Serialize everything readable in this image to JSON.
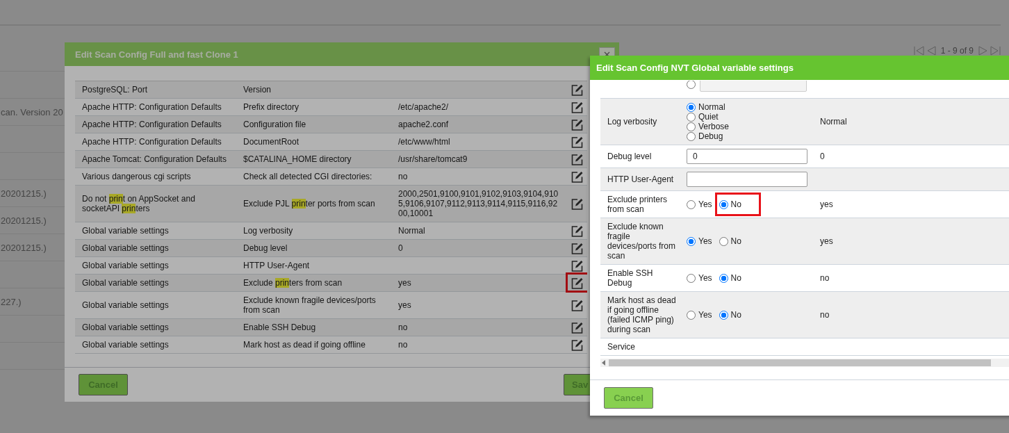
{
  "background_page": {
    "pager": {
      "text": "1 - 9 of 9"
    },
    "rows": [
      {},
      {},
      {
        "text": "can. Version 20"
      },
      {},
      {},
      {
        "text": "20201215.)"
      },
      {
        "text": "20201215.)"
      },
      {
        "text": "20201215.)"
      },
      {},
      {
        "text": "227.)"
      },
      {},
      {}
    ]
  },
  "config_dialog": {
    "title": "Edit Scan Config Full and fast Clone 1",
    "rows": [
      {
        "nvt": "PostgreSQL: Port",
        "name": "Version",
        "highlighted": false
      },
      {
        "nvt": "Apache HTTP: Configuration Defaults",
        "name": "Prefix directory",
        "value": "/etc/apache2/",
        "highlighted": false
      },
      {
        "nvt": "Apache HTTP: Configuration Defaults",
        "name": "Configuration file",
        "value": "apache2.conf",
        "highlighted": false
      },
      {
        "nvt": "Apache HTTP: Configuration Defaults",
        "name": "DocumentRoot",
        "value": "/etc/www/html",
        "highlighted": false
      },
      {
        "nvt": "Apache Tomcat: Configuration Defaults",
        "name": "$CATALINA_HOME directory",
        "value": "/usr/share/tomcat9",
        "highlighted": false
      },
      {
        "nvt": "Various dangerous cgi scripts",
        "name": "Check all detected CGI directories:",
        "value": "no",
        "highlighted": false
      },
      {
        "nvt": "Do not **prin**t on AppSocket and socketAPI **prin**ters",
        "name": "Exclude PJL **prin**ter ports from scan",
        "value": "2000,2501,9100,9101,9102,9103,9104,9105,9106,9107,9112,9113,9114,9115,9116,9200,10001",
        "highlighted": false
      },
      {
        "nvt": "Global variable settings",
        "name": "Log verbosity",
        "value": "Normal",
        "highlighted": false
      },
      {
        "nvt": "Global variable settings",
        "name": "Debug level",
        "value": "0",
        "highlighted": false
      },
      {
        "nvt": "Global variable settings",
        "name": "HTTP User-Agent",
        "highlighted": false
      },
      {
        "nvt": "Global variable settings",
        "name": "Exclude **prin**ters from scan",
        "value": "yes",
        "highlighted": true
      },
      {
        "nvt": "Global variable settings",
        "name": "Exclude known fragile devices/ports from scan",
        "value": "yes",
        "highlighted": false
      },
      {
        "nvt": "Global variable settings",
        "name": "Enable SSH Debug",
        "value": "no",
        "highlighted": false
      },
      {
        "nvt": "Global variable settings",
        "name": "Mark host as dead if going offline",
        "value": "no",
        "highlighted": false
      }
    ],
    "buttons": [
      "Cancel",
      "Sav"
    ]
  },
  "nvt_dialog": {
    "title": "Edit Scan Config NVT Global variable settings",
    "rows": [
      {
        "kind": "radio-field",
        "selected": false
      },
      {
        "kind": "radio-list",
        "label": "Log verbosity",
        "options": [
          {
            "label": "Normal",
            "selected": true
          },
          {
            "label": "Quiet",
            "selected": false
          },
          {
            "label": "Verbose",
            "selected": false
          },
          {
            "label": "Debug",
            "selected": false
          }
        ],
        "value": "Normal"
      },
      {
        "kind": "text-field",
        "label": "Debug level",
        "field_value": "0",
        "value": "0"
      },
      {
        "kind": "text-field",
        "label": "HTTP User-Agent"
      },
      {
        "kind": "yes-no",
        "label": "Exclude printers from scan",
        "options": [
          {
            "label": "Yes",
            "selected": false,
            "highlighted": false
          },
          {
            "label": "No",
            "selected": true,
            "highlighted": true
          }
        ],
        "value": "yes"
      },
      {
        "kind": "yes-no",
        "label": "Exclude known fragile devices/ports from scan",
        "options": [
          {
            "label": "Yes",
            "selected": true,
            "highlighted": false
          },
          {
            "label": "No",
            "selected": false,
            "highlighted": false
          }
        ],
        "value": "yes"
      },
      {
        "kind": "yes-no",
        "label": "Enable SSH Debug",
        "options": [
          {
            "label": "Yes",
            "selected": false,
            "highlighted": false
          },
          {
            "label": "No",
            "selected": true,
            "highlighted": false
          }
        ],
        "value": "no"
      },
      {
        "kind": "yes-no",
        "label": "Mark host as dead if going offline (failed ICMP ping) during scan",
        "options": [
          {
            "label": "Yes",
            "selected": false,
            "highlighted": false
          },
          {
            "label": "No",
            "selected": true,
            "highlighted": false
          }
        ],
        "value": "no"
      },
      {
        "kind": "label-only",
        "label": "Service"
      }
    ],
    "buttons": [
      "Cancel"
    ]
  }
}
